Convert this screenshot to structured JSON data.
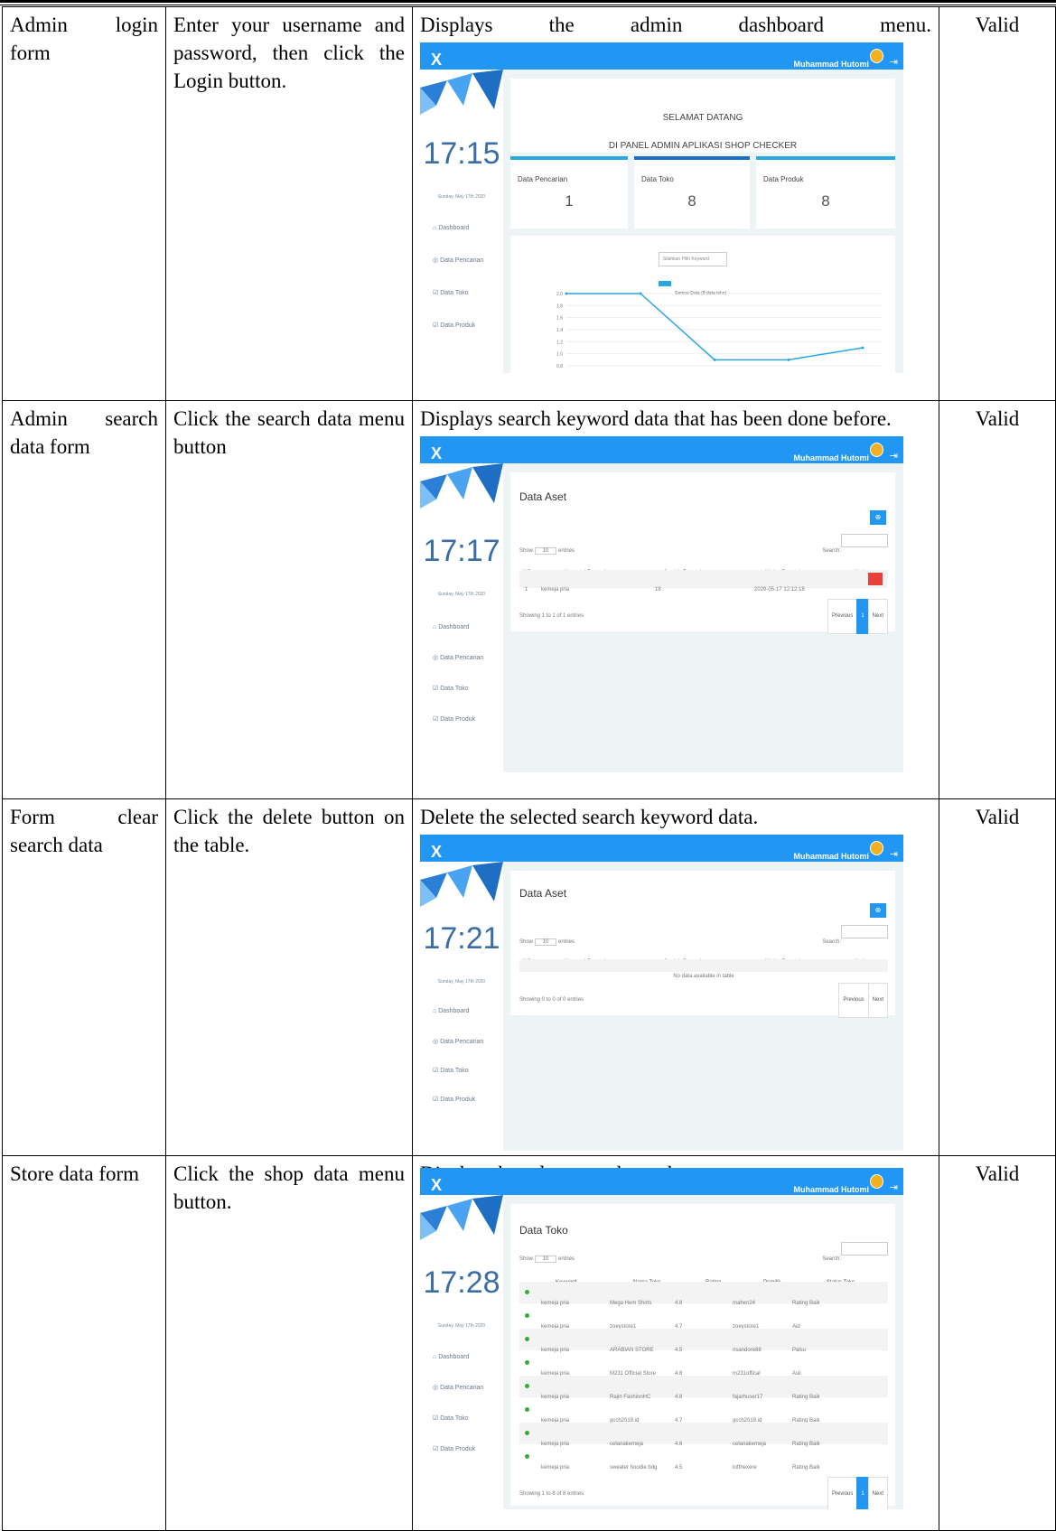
{
  "rows": [
    {
      "col1": "Admin login form",
      "col2": "Enter your username and password, then click the Login button.",
      "col3": "Displays the admin dashboard menu.",
      "col4": "Valid",
      "screen": {
        "user": "Muhammad Hutomi",
        "close": "X",
        "clock": "17:15",
        "date": "Sunday, May 17th 2020",
        "nav": [
          "Dashboard",
          "Data Pencarian",
          "Data Toko",
          "Data Produk"
        ],
        "welcome_line1": "SELAMAT DATANG",
        "welcome_line2": "DI PANEL ADMIN APLIKASI SHOP CHECKER",
        "cards": [
          {
            "label": "Data Pencarian",
            "value": "1"
          },
          {
            "label": "Data Toko",
            "value": "8"
          },
          {
            "label": "Data Produk",
            "value": "8"
          }
        ],
        "select_text": "Silahkan Pilih Keyword",
        "legend": "Semua Data (8 data toko)",
        "chart_data": {
          "type": "line",
          "series": [
            {
              "name": "Semua Data (8 data toko)",
              "values": [
                2.0,
                2.0,
                0.9,
                0.9,
                1.1
              ]
            }
          ],
          "y_ticks": [
            "2.0",
            "1.8",
            "1.6",
            "1.4",
            "1.2",
            "1.0",
            "0.8"
          ],
          "ylim": [
            0.8,
            2.0
          ]
        }
      }
    },
    {
      "col1": "Admin search data form",
      "col2": "Click the search data menu button",
      "col3": "Displays search keyword data that has been done before.",
      "col4": "Valid",
      "screen": {
        "user": "Muhammad Hutomi",
        "close": "X",
        "clock": "17:17",
        "date": "Sunday, May 17th 2020",
        "nav": [
          "Dashboard",
          "Data Pencarian",
          "Data Toko",
          "Data Produk"
        ],
        "panel_title": "Data Aset",
        "show": "Show",
        "show_val": "10",
        "entries": "entries",
        "search": "Search:",
        "headers": [
          "NO",
          "Keyword Pencarian",
          "Jumlah Pencarian",
          "Waktu Pencarian",
          "Aksi"
        ],
        "table": [
          [
            "1",
            "kemeja pria",
            "18",
            "2020-05-17 12:12:18"
          ]
        ],
        "info": "Showing 1 to 1 of 1 entries",
        "prev": "Previous",
        "page": "1",
        "next": "Next"
      }
    },
    {
      "col1": "Form clear search data",
      "col2": "Click the delete button on the table.",
      "col3": "Delete the selected search keyword data.",
      "col4": "Valid",
      "screen": {
        "user": "Muhammad Hutomi",
        "close": "X",
        "clock": "17:21",
        "date": "Sunday, May 17th 2020",
        "nav": [
          "Dashboard",
          "Data Pencarian",
          "Data Toko",
          "Data Produk"
        ],
        "panel_title": "Data Aset",
        "show": "Show",
        "show_val": "10",
        "entries": "entries",
        "search": "Search:",
        "headers": [
          "NO",
          "Keyword Pencarian",
          "Jumlah Pencarian",
          "Waktu Pencarian",
          "Aksi"
        ],
        "empty": "No data available in table",
        "info": "Showing 0 to 0 of 0 entries",
        "prev": "Previous",
        "next": "Next"
      }
    },
    {
      "col1": "Store data form",
      "col2": "Click the shop data menu button.",
      "col3": "Display shop data search results.",
      "col4": "Valid",
      "screen": {
        "user": "Muhammad Hutomi",
        "close": "X",
        "clock": "17:28",
        "date": "Sunday, May 17th 2020",
        "nav": [
          "Dashboard",
          "Data Pencarian",
          "Data Toko",
          "Data Produk"
        ],
        "panel_title": "Data Toko",
        "show": "Show",
        "show_val": "10",
        "entries": "entries",
        "search": "Search:",
        "headers": [
          "Keyword",
          "Nama Toko",
          "Rating",
          "Pemilik",
          "Status Toko"
        ],
        "table": [
          [
            "kemeja pria",
            "Mega Hem Shirts",
            "4.8",
            "mahen24",
            "Rating Baik"
          ],
          [
            "kemeja pria",
            "zoeystore1",
            "4.7",
            "zoeystore1",
            "Aid"
          ],
          [
            "kemeja pria",
            "ARABIAN STORE",
            "4.5",
            "risandore88",
            "Palsu"
          ],
          [
            "kemeja pria",
            "M231 Official Store",
            "4.8",
            "m231offical",
            "Asli"
          ],
          [
            "kemeja pria",
            "Rajin FashionHC",
            "4.8",
            "fajarhuser17",
            "Rating Baik"
          ],
          [
            "kemeja pria",
            "gcch2019.id",
            "4.7",
            "gcch2019.id",
            "Rating Baik"
          ],
          [
            "kemeja pria",
            "celanakemeja",
            "4.6",
            "celanakemeja",
            "Rating Baik"
          ],
          [
            "kemeja pria",
            "sweater hoodie bdg",
            "4.5",
            "tofthexere",
            "Rating Baik"
          ]
        ],
        "info": "Showing 1 to 8 of 8 entries",
        "prev": "Previous",
        "page": "1",
        "next": "Next"
      }
    }
  ]
}
